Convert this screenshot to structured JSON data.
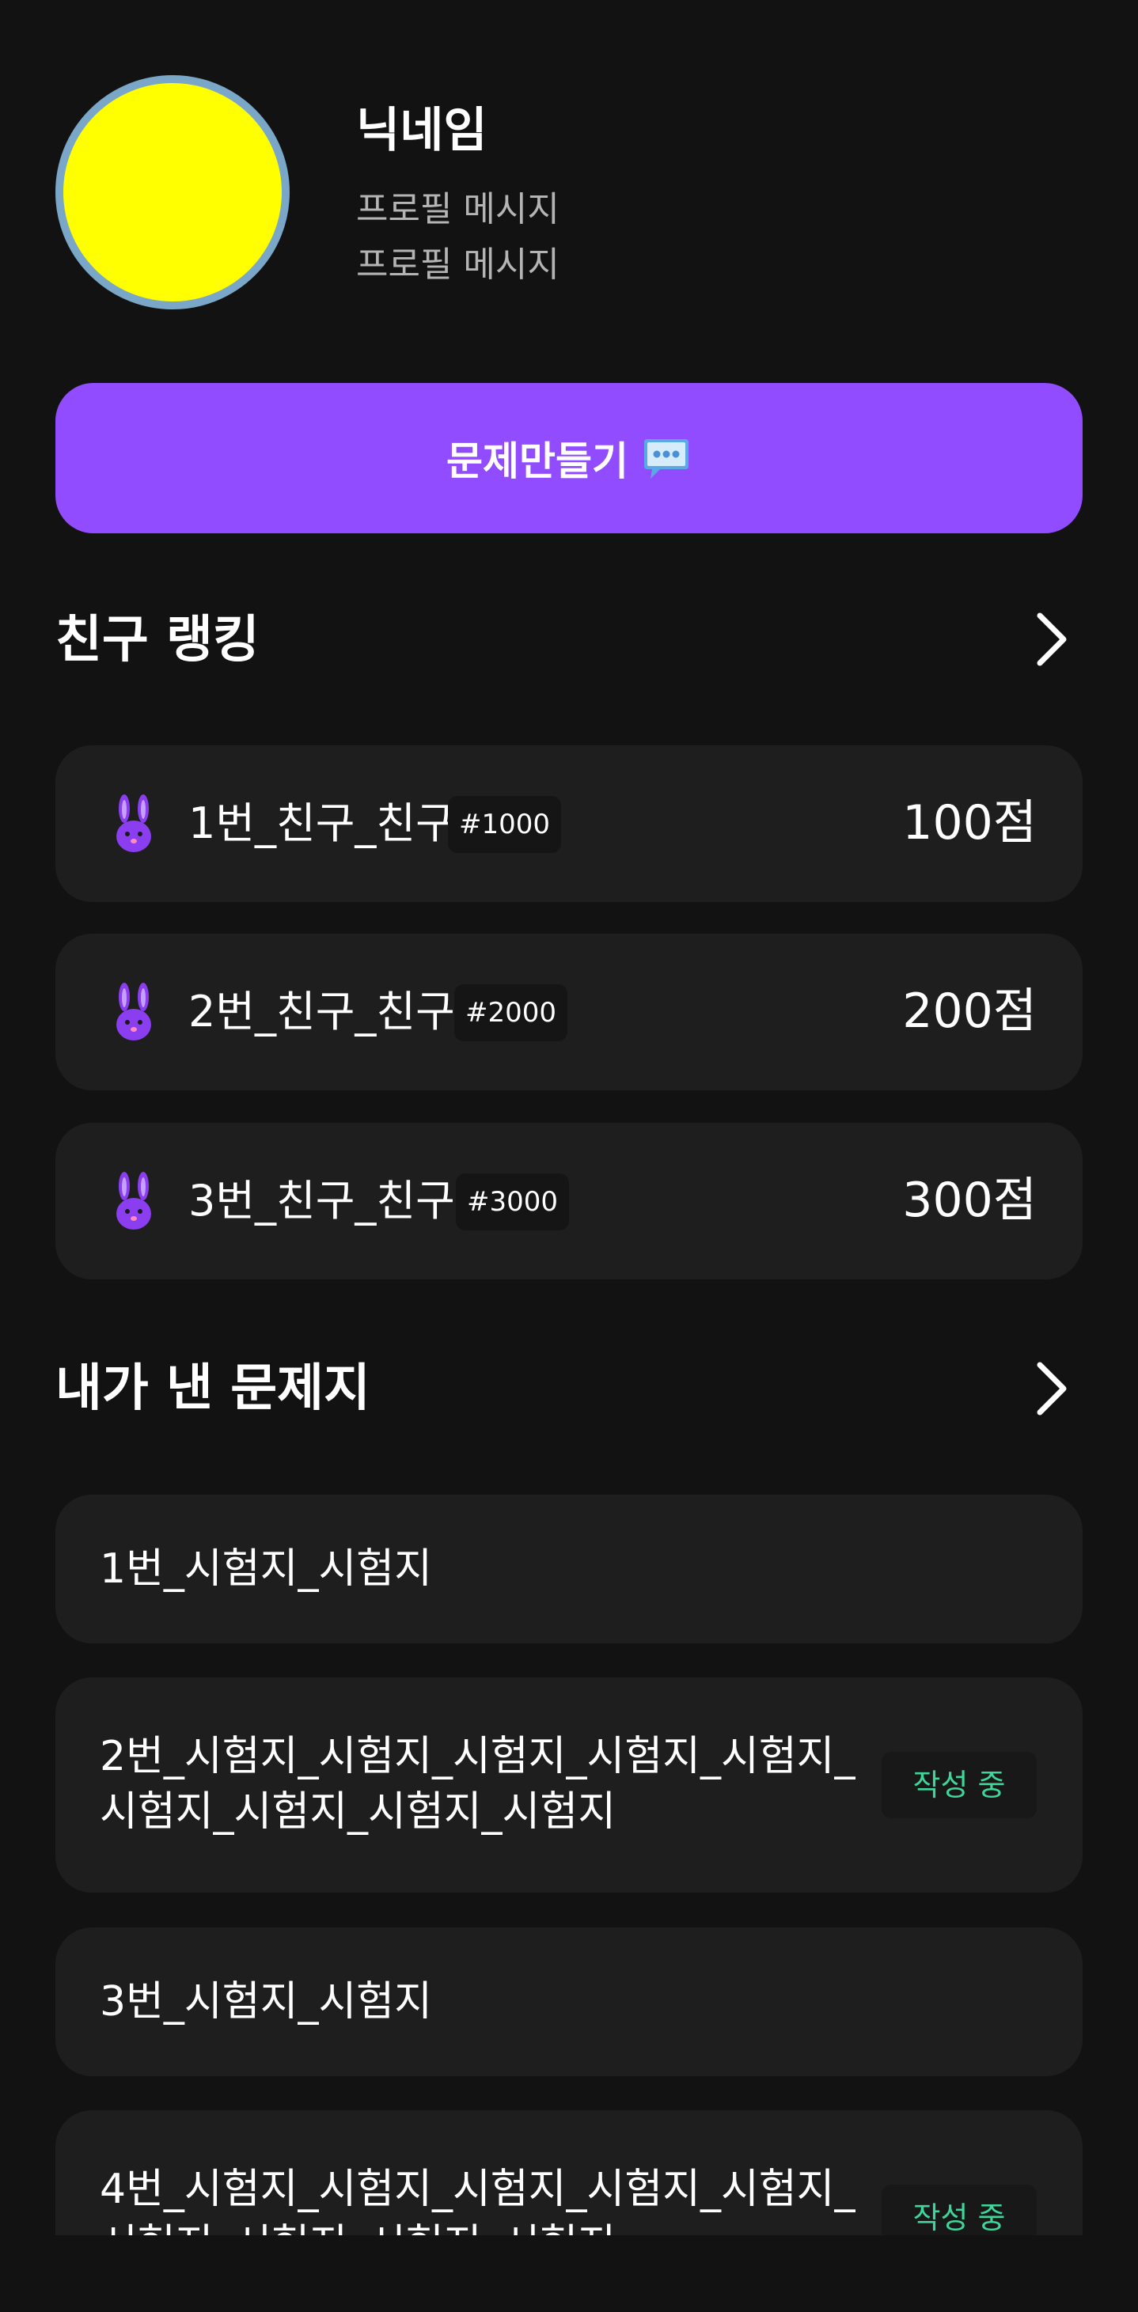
{
  "profile": {
    "nickname": "닉네임",
    "message_line1": "프로필 메시지",
    "message_line2": "프로필 메시지",
    "avatar_color": "#ffff00",
    "avatar_border_color": "#7aa7c7"
  },
  "create_button": {
    "label": "문제만들기",
    "icon": "speech-bubble-icon",
    "color": "#924cff"
  },
  "friend_ranking": {
    "title": "친구 랭킹",
    "items": [
      {
        "name": "1번_친구_친구",
        "tag": "#1000",
        "score": "100점",
        "icon": "rabbit-icon"
      },
      {
        "name": "2번_친구_친구",
        "tag": "#2000",
        "score": "200점",
        "icon": "rabbit-icon"
      },
      {
        "name": "3번_친구_친구",
        "tag": "#3000",
        "score": "300점",
        "icon": "rabbit-icon"
      }
    ]
  },
  "my_tests": {
    "title": "내가 낸 문제지",
    "items": [
      {
        "line1": "1번_시험지_시험지",
        "line2": "",
        "badge": ""
      },
      {
        "line1": "2번_시험지_시험지_시험지_시험지_시험지_",
        "line2": "시험지_시험지_시험지_시험지",
        "badge": "작성 중"
      },
      {
        "line1": "3번_시험지_시험지",
        "line2": "",
        "badge": ""
      },
      {
        "line1": "4번_시험지_시험지_시험지_시험지_시험지_",
        "line2": "시험지_시험지_시험지_시험지",
        "badge": "작성 중"
      }
    ]
  },
  "colors": {
    "background": "#121212",
    "card": "#1e1e1e",
    "accent": "#924cff",
    "badge_text": "#3ed69a",
    "muted_text": "#b4b4b4"
  }
}
